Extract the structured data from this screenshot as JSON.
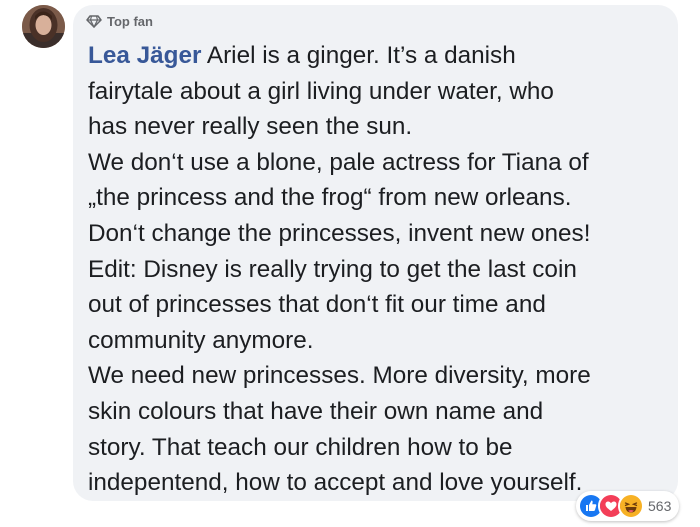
{
  "comment": {
    "badge_label": "Top fan",
    "author": "Lea Jäger",
    "lines": [
      "Ariel is a ginger. It’s a danish",
      "fairytale about a girl living under water, who",
      "has never really seen the sun.",
      "We don‘t use a blone, pale actress for Tiana of",
      "„the princess and the frog“ from new orleans.",
      "Don‘t change the princesses, invent new ones!",
      "Edit: Disney is really trying to get the last coin",
      "out of princesses that don‘t fit our time and",
      "community anymore.",
      "We need new princesses. More diversity, more",
      "skin colours that have their own name and",
      "story. That teach our children how to be",
      "indepentend, how to accept and love yourself."
    ]
  },
  "reactions": {
    "icons": [
      "like-icon",
      "love-icon",
      "haha-icon"
    ],
    "count": "563"
  },
  "colors": {
    "bubble": "#f0f2f5",
    "author": "#385898",
    "text": "#1c1e21",
    "meta": "#65676b",
    "like": "#1877f2",
    "love": "#f33e58",
    "haha": "#f7b125"
  }
}
